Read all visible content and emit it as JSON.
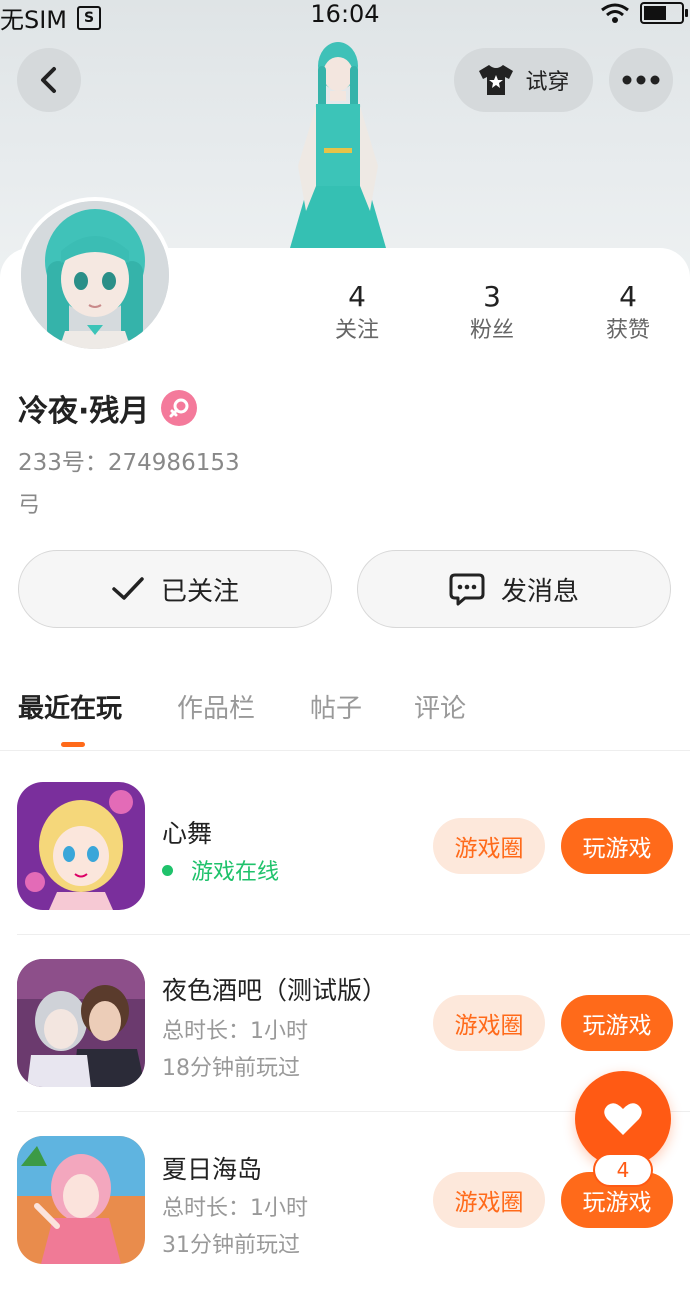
{
  "status_bar": {
    "carrier": "无SIM",
    "time": "16:04"
  },
  "header": {
    "tryon_label": "试穿"
  },
  "stats": [
    {
      "num": "4",
      "label": "关注"
    },
    {
      "num": "3",
      "label": "粉丝"
    },
    {
      "num": "4",
      "label": "获赞"
    }
  ],
  "profile": {
    "name": "冷夜·残月",
    "id_line": "233号：274986153",
    "bio": "弓"
  },
  "actions": {
    "follow_label": "已关注",
    "message_label": "发消息"
  },
  "tabs": [
    {
      "label": "最近在玩"
    },
    {
      "label": "作品栏"
    },
    {
      "label": "帖子"
    },
    {
      "label": "评论"
    }
  ],
  "games": [
    {
      "title": "心舞",
      "status": "游戏在线",
      "circle_label": "游戏圈",
      "play_label": "玩游戏"
    },
    {
      "title": "夜色酒吧（测试版）",
      "duration": "总时长：1小时",
      "last_played": "18分钟前玩过",
      "circle_label": "游戏圈",
      "play_label": "玩游戏"
    },
    {
      "title": "夏日海岛",
      "duration": "总时长：1小时",
      "last_played": "31分钟前玩过",
      "circle_label": "游戏圈",
      "play_label": "玩游戏"
    }
  ],
  "like_fab": {
    "count": "4"
  },
  "colors": {
    "accent": "#ff6a1a",
    "online": "#1fc26b",
    "gender": "#f47a9b"
  }
}
